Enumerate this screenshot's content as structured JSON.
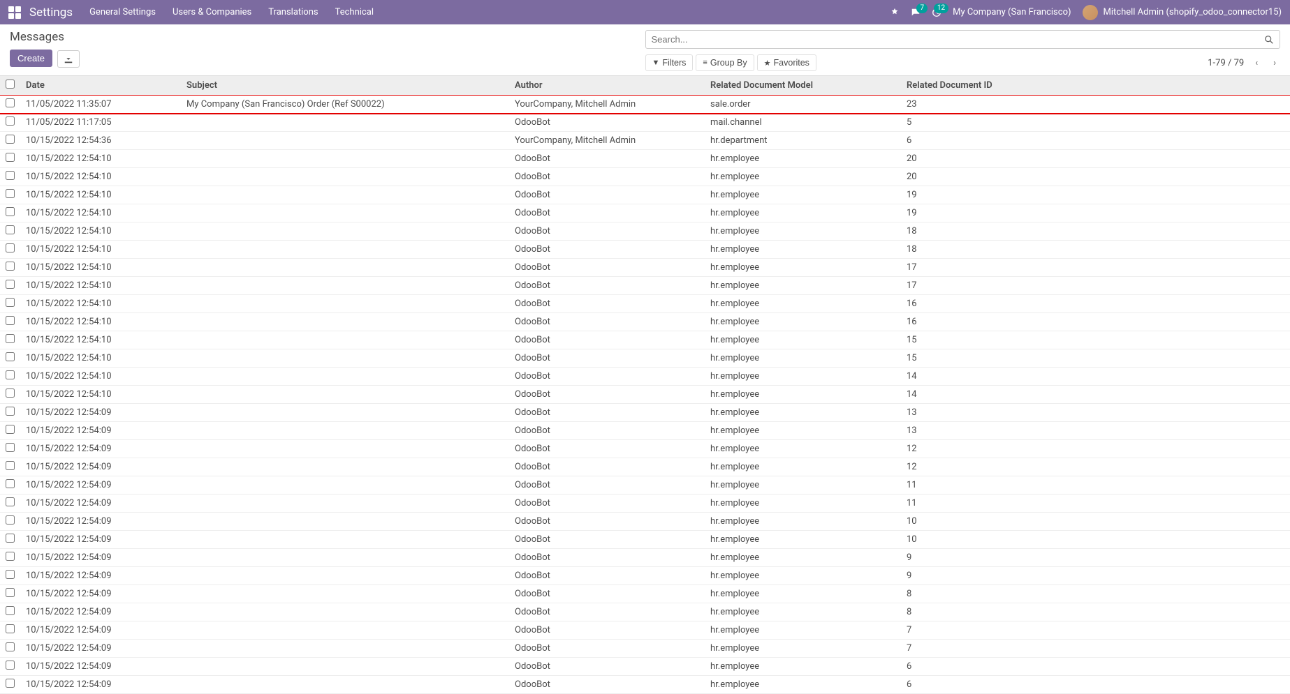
{
  "nav": {
    "brand": "Settings",
    "links": [
      "General Settings",
      "Users & Companies",
      "Translations",
      "Technical"
    ],
    "chat_badge": "7",
    "activity_badge": "12",
    "company": "My Company (San Francisco)",
    "user": "Mitchell Admin (shopify_odoo_connector15)"
  },
  "page": {
    "title": "Messages",
    "create_label": "Create",
    "search_placeholder": "Search...",
    "filters_label": "Filters",
    "groupby_label": "Group By",
    "favorites_label": "Favorites",
    "pager": "1-79 / 79"
  },
  "table": {
    "headers": {
      "date": "Date",
      "subject": "Subject",
      "author": "Author",
      "model": "Related Document Model",
      "id": "Related Document ID"
    },
    "rows": [
      {
        "date": "11/05/2022 11:35:07",
        "subject": "My Company (San Francisco) Order (Ref S00022)",
        "author": "YourCompany, Mitchell Admin",
        "model": "sale.order",
        "id": "23",
        "highlight": true
      },
      {
        "date": "11/05/2022 11:17:05",
        "subject": "",
        "author": "OdooBot",
        "model": "mail.channel",
        "id": "5"
      },
      {
        "date": "10/15/2022 12:54:36",
        "subject": "",
        "author": "YourCompany, Mitchell Admin",
        "model": "hr.department",
        "id": "6"
      },
      {
        "date": "10/15/2022 12:54:10",
        "subject": "",
        "author": "OdooBot",
        "model": "hr.employee",
        "id": "20"
      },
      {
        "date": "10/15/2022 12:54:10",
        "subject": "",
        "author": "OdooBot",
        "model": "hr.employee",
        "id": "20"
      },
      {
        "date": "10/15/2022 12:54:10",
        "subject": "",
        "author": "OdooBot",
        "model": "hr.employee",
        "id": "19"
      },
      {
        "date": "10/15/2022 12:54:10",
        "subject": "",
        "author": "OdooBot",
        "model": "hr.employee",
        "id": "19"
      },
      {
        "date": "10/15/2022 12:54:10",
        "subject": "",
        "author": "OdooBot",
        "model": "hr.employee",
        "id": "18"
      },
      {
        "date": "10/15/2022 12:54:10",
        "subject": "",
        "author": "OdooBot",
        "model": "hr.employee",
        "id": "18"
      },
      {
        "date": "10/15/2022 12:54:10",
        "subject": "",
        "author": "OdooBot",
        "model": "hr.employee",
        "id": "17"
      },
      {
        "date": "10/15/2022 12:54:10",
        "subject": "",
        "author": "OdooBot",
        "model": "hr.employee",
        "id": "17"
      },
      {
        "date": "10/15/2022 12:54:10",
        "subject": "",
        "author": "OdooBot",
        "model": "hr.employee",
        "id": "16"
      },
      {
        "date": "10/15/2022 12:54:10",
        "subject": "",
        "author": "OdooBot",
        "model": "hr.employee",
        "id": "16"
      },
      {
        "date": "10/15/2022 12:54:10",
        "subject": "",
        "author": "OdooBot",
        "model": "hr.employee",
        "id": "15"
      },
      {
        "date": "10/15/2022 12:54:10",
        "subject": "",
        "author": "OdooBot",
        "model": "hr.employee",
        "id": "15"
      },
      {
        "date": "10/15/2022 12:54:10",
        "subject": "",
        "author": "OdooBot",
        "model": "hr.employee",
        "id": "14"
      },
      {
        "date": "10/15/2022 12:54:10",
        "subject": "",
        "author": "OdooBot",
        "model": "hr.employee",
        "id": "14"
      },
      {
        "date": "10/15/2022 12:54:09",
        "subject": "",
        "author": "OdooBot",
        "model": "hr.employee",
        "id": "13"
      },
      {
        "date": "10/15/2022 12:54:09",
        "subject": "",
        "author": "OdooBot",
        "model": "hr.employee",
        "id": "13"
      },
      {
        "date": "10/15/2022 12:54:09",
        "subject": "",
        "author": "OdooBot",
        "model": "hr.employee",
        "id": "12"
      },
      {
        "date": "10/15/2022 12:54:09",
        "subject": "",
        "author": "OdooBot",
        "model": "hr.employee",
        "id": "12"
      },
      {
        "date": "10/15/2022 12:54:09",
        "subject": "",
        "author": "OdooBot",
        "model": "hr.employee",
        "id": "11"
      },
      {
        "date": "10/15/2022 12:54:09",
        "subject": "",
        "author": "OdooBot",
        "model": "hr.employee",
        "id": "11"
      },
      {
        "date": "10/15/2022 12:54:09",
        "subject": "",
        "author": "OdooBot",
        "model": "hr.employee",
        "id": "10"
      },
      {
        "date": "10/15/2022 12:54:09",
        "subject": "",
        "author": "OdooBot",
        "model": "hr.employee",
        "id": "10"
      },
      {
        "date": "10/15/2022 12:54:09",
        "subject": "",
        "author": "OdooBot",
        "model": "hr.employee",
        "id": "9"
      },
      {
        "date": "10/15/2022 12:54:09",
        "subject": "",
        "author": "OdooBot",
        "model": "hr.employee",
        "id": "9"
      },
      {
        "date": "10/15/2022 12:54:09",
        "subject": "",
        "author": "OdooBot",
        "model": "hr.employee",
        "id": "8"
      },
      {
        "date": "10/15/2022 12:54:09",
        "subject": "",
        "author": "OdooBot",
        "model": "hr.employee",
        "id": "8"
      },
      {
        "date": "10/15/2022 12:54:09",
        "subject": "",
        "author": "OdooBot",
        "model": "hr.employee",
        "id": "7"
      },
      {
        "date": "10/15/2022 12:54:09",
        "subject": "",
        "author": "OdooBot",
        "model": "hr.employee",
        "id": "7"
      },
      {
        "date": "10/15/2022 12:54:09",
        "subject": "",
        "author": "OdooBot",
        "model": "hr.employee",
        "id": "6"
      },
      {
        "date": "10/15/2022 12:54:09",
        "subject": "",
        "author": "OdooBot",
        "model": "hr.employee",
        "id": "6"
      }
    ]
  }
}
